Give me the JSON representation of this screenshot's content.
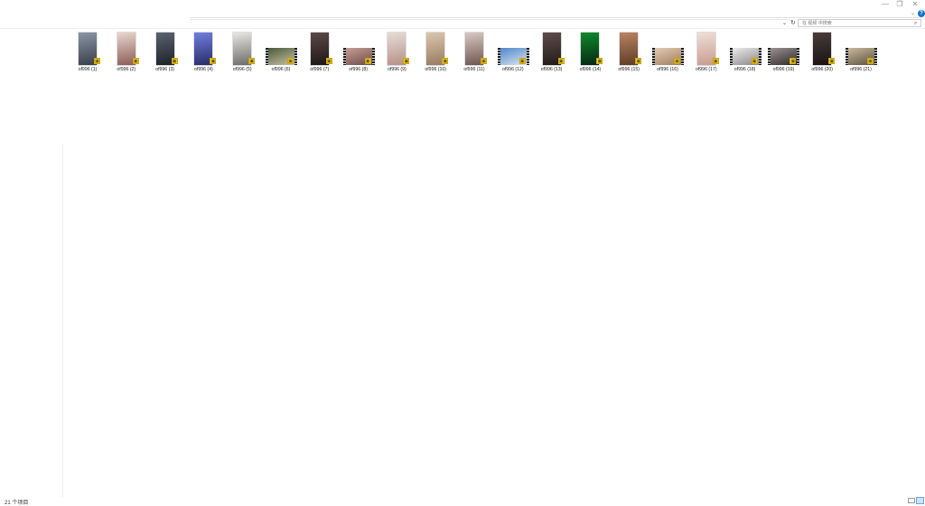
{
  "window": {
    "min_icon": "minimize-icon",
    "max_icon": "restore-icon",
    "close_icon": "close-icon",
    "min_glyph": "—",
    "max_glyph": "❐",
    "close_glyph": "✕"
  },
  "ribbon": {
    "collapse_glyph": "⌄",
    "help_glyph": "?"
  },
  "address": {
    "dropdown_glyph": "⌄",
    "refresh_glyph": "↻"
  },
  "search": {
    "placeholder": "在 视频 中搜索",
    "icon_glyph": "⌕"
  },
  "colors": {
    "accent": "#1a73c8",
    "badge": "#f5cf2b"
  },
  "files": [
    {
      "name": "of996 (1)",
      "kind": "image",
      "c1": "#8a95a6",
      "c2": "#3a3f4a"
    },
    {
      "name": "of996 (2)",
      "kind": "image",
      "c1": "#e9d6cf",
      "c2": "#8b5c55"
    },
    {
      "name": "of996 (3)",
      "kind": "image",
      "c1": "#5b6270",
      "c2": "#1d2128"
    },
    {
      "name": "of996 (4)",
      "kind": "image",
      "c1": "#6f7fe0",
      "c2": "#2a2c66"
    },
    {
      "name": "of996 (5)",
      "kind": "image",
      "c1": "#e9e7e4",
      "c2": "#6d6b68"
    },
    {
      "name": "of996 (6)",
      "kind": "video",
      "c1": "#4a5a38",
      "c2": "#c9c2a8"
    },
    {
      "name": "of996 (7)",
      "kind": "image",
      "c1": "#5b4a48",
      "c2": "#1e1716"
    },
    {
      "name": "of996 (8)",
      "kind": "video",
      "c1": "#c79e96",
      "c2": "#6d4a46"
    },
    {
      "name": "of996 (9)",
      "kind": "image",
      "c1": "#e7dcd7",
      "c2": "#b59187"
    },
    {
      "name": "of996 (10)",
      "kind": "image",
      "c1": "#d9c6ad",
      "c2": "#9a7b61"
    },
    {
      "name": "of996 (11)",
      "kind": "image",
      "c1": "#d8c9c2",
      "c2": "#6f5650"
    },
    {
      "name": "of996 (12)",
      "kind": "video",
      "c1": "#4f86c8",
      "c2": "#d9e6f0"
    },
    {
      "name": "of996 (13)",
      "kind": "image",
      "c1": "#5e4d4a",
      "c2": "#231b19"
    },
    {
      "name": "of996 (14)",
      "kind": "image",
      "c1": "#0e8a2e",
      "c2": "#062712"
    },
    {
      "name": "of996 (15)",
      "kind": "image",
      "c1": "#b88460",
      "c2": "#5e3b27"
    },
    {
      "name": "of996 (16)",
      "kind": "video",
      "c1": "#e3cbb2",
      "c2": "#a07d60"
    },
    {
      "name": "of996 (17)",
      "kind": "image",
      "c1": "#f0dfd8",
      "c2": "#c79b8f"
    },
    {
      "name": "of996 (18)",
      "kind": "video",
      "c1": "#ececec",
      "c2": "#8a8686"
    },
    {
      "name": "of996 (19)",
      "kind": "video",
      "c1": "#9a9192",
      "c2": "#2e2a2b"
    },
    {
      "name": "of996 (20)",
      "kind": "image",
      "c1": "#4a3c3a",
      "c2": "#1a1312"
    },
    {
      "name": "of996 (21)",
      "kind": "video",
      "c1": "#c9b99d",
      "c2": "#5b5040"
    }
  ],
  "status": {
    "item_count": "21 个项目"
  }
}
